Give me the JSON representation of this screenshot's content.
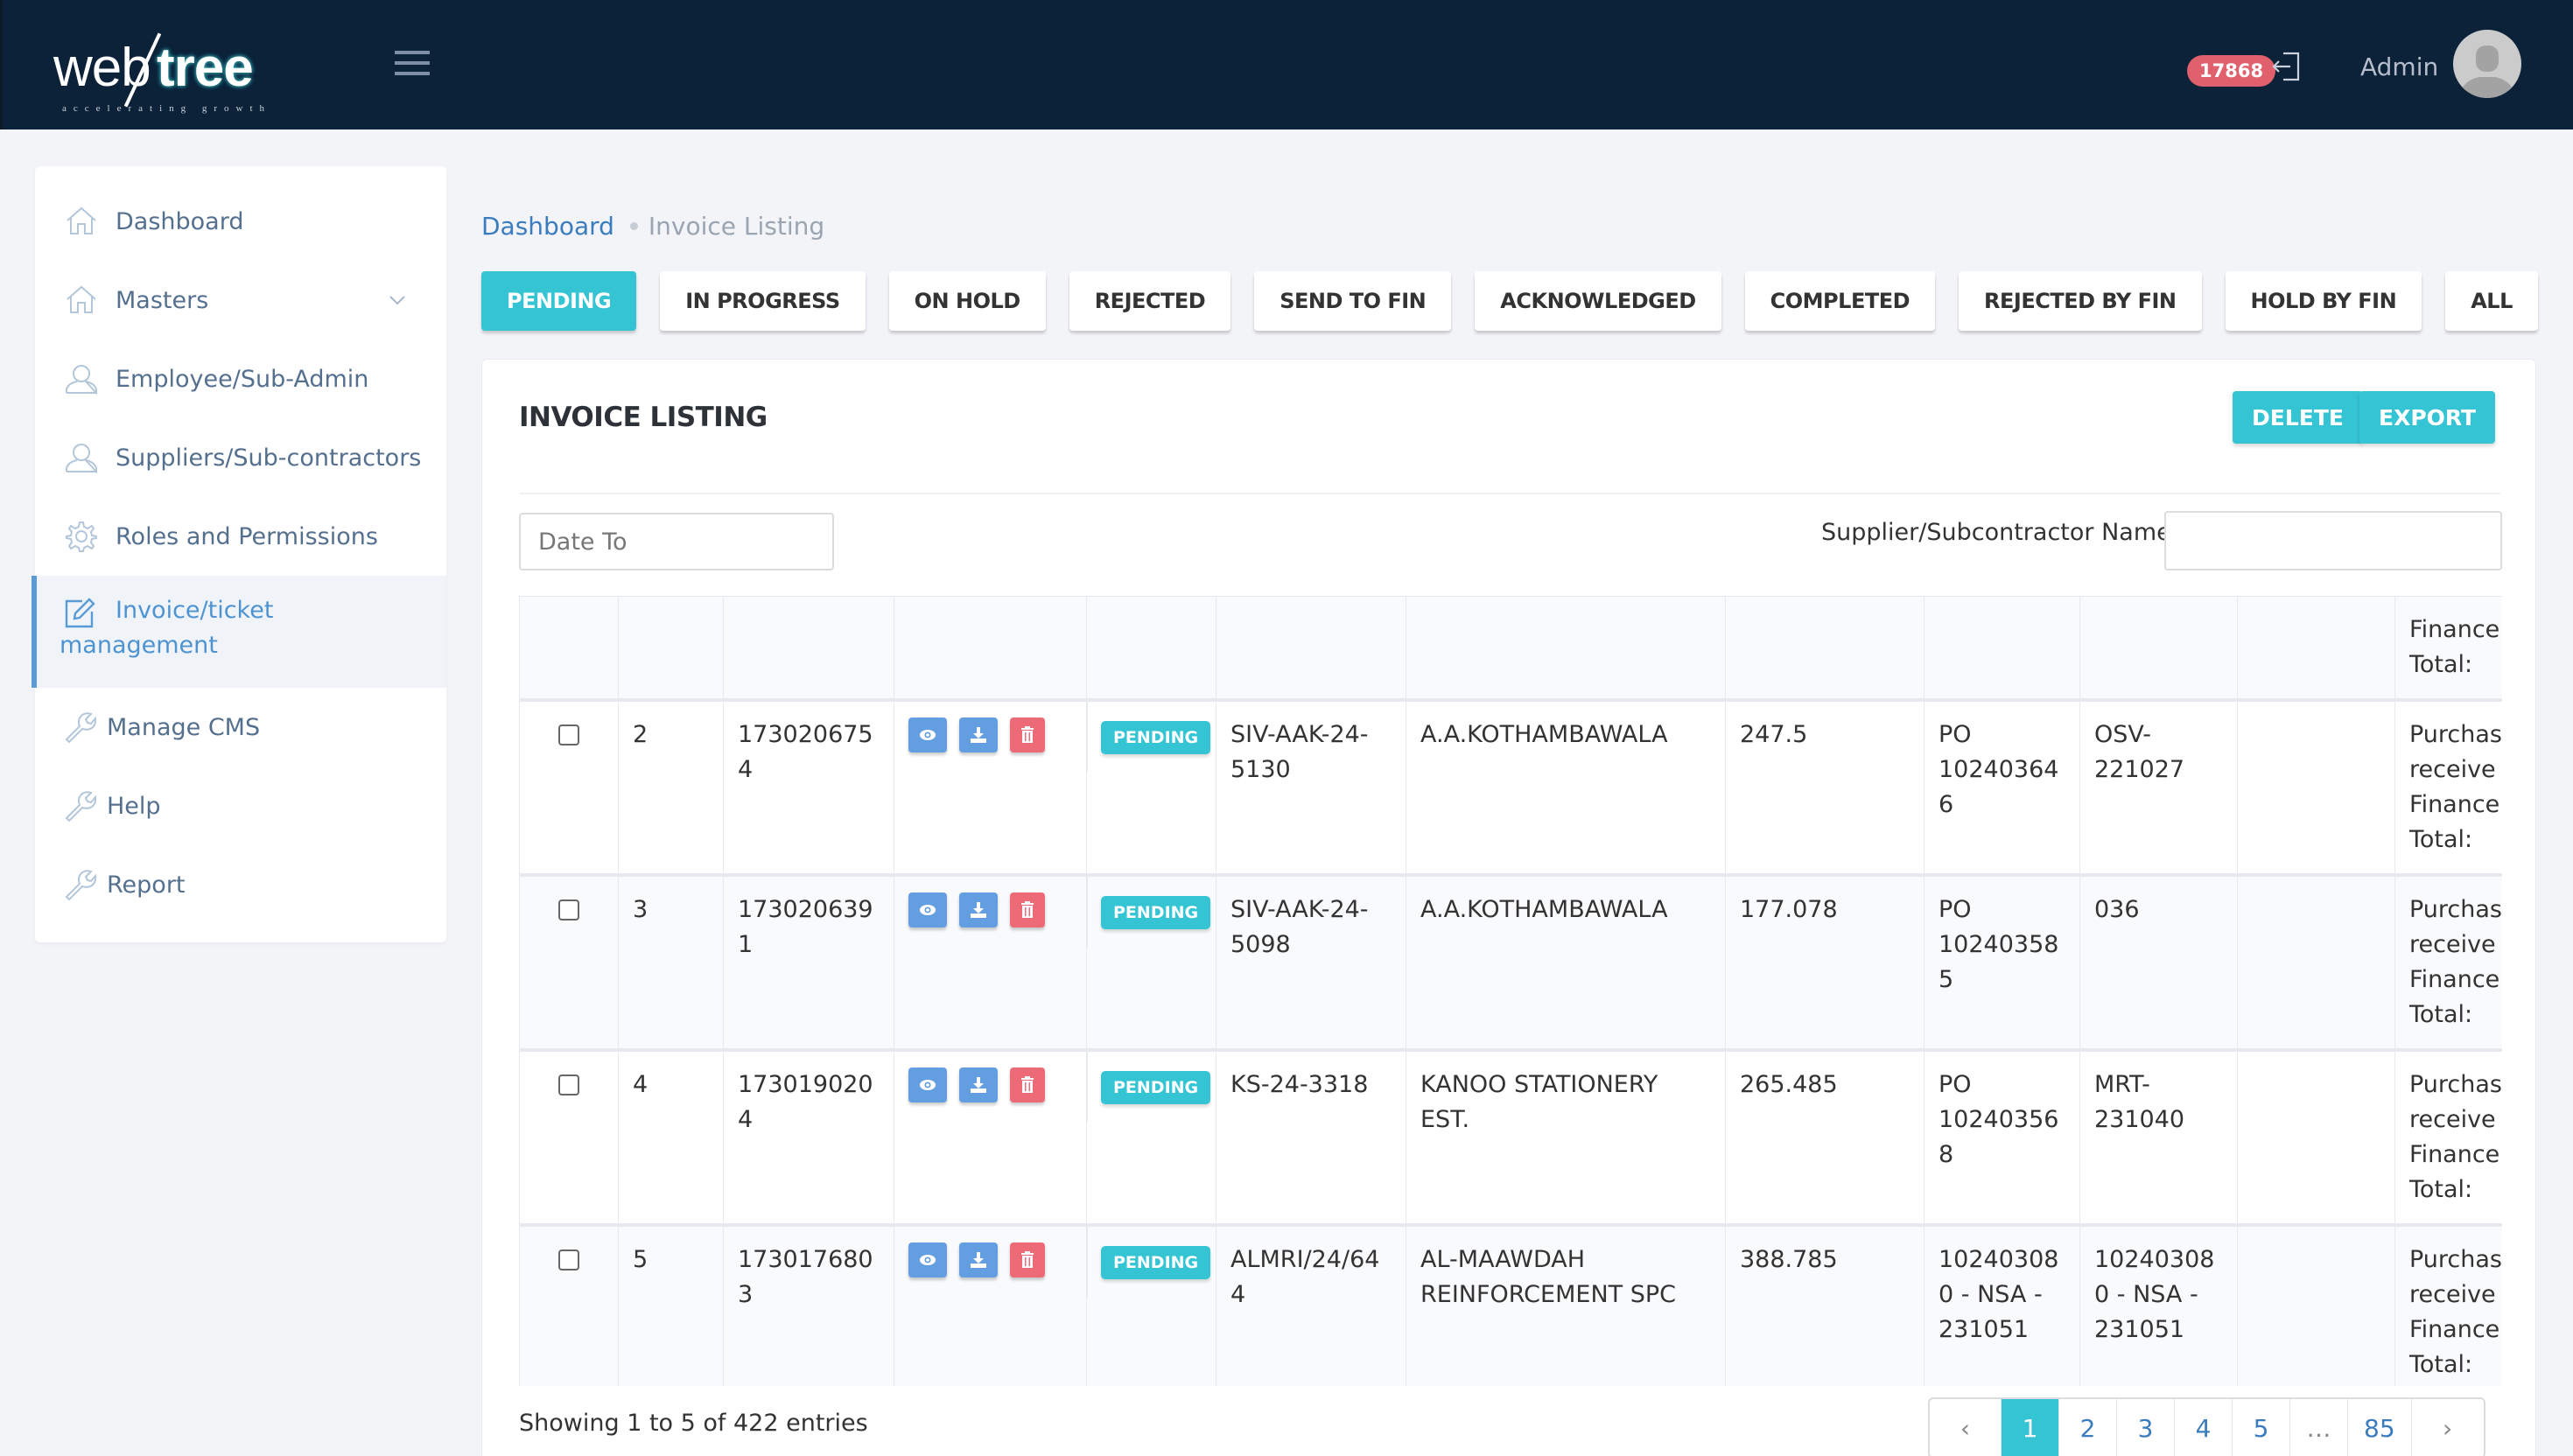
{
  "header": {
    "logo_text_web": "web",
    "logo_text_tree": "tree",
    "logo_tagline": "accelerating growth",
    "notification_count": "17868",
    "user_name": "Admin"
  },
  "sidebar": {
    "items": [
      {
        "label": "Dashboard",
        "icon": "home-icon"
      },
      {
        "label": "Masters",
        "icon": "home-icon",
        "has_dropdown": true
      },
      {
        "label": "Employee/Sub-Admin",
        "icon": "user-icon"
      },
      {
        "label": "Suppliers/Sub-contractors",
        "icon": "user-icon"
      },
      {
        "label": "Roles and Permissions",
        "icon": "gear-icon"
      },
      {
        "label": "Invoice/ticket management",
        "icon": "edit-icon",
        "active": true
      },
      {
        "label": "Manage CMS",
        "icon": "wrench-icon"
      },
      {
        "label": "Help",
        "icon": "wrench-icon"
      },
      {
        "label": "Report",
        "icon": "wrench-icon"
      }
    ]
  },
  "breadcrumb": {
    "parent": "Dashboard",
    "current": "Invoice Listing"
  },
  "status_tabs": [
    {
      "label": "PENDING",
      "active": true
    },
    {
      "label": "IN PROGRESS"
    },
    {
      "label": "ON HOLD"
    },
    {
      "label": "REJECTED"
    },
    {
      "label": "SEND TO FIN"
    },
    {
      "label": "ACKNOWLEDGED"
    },
    {
      "label": "COMPLETED"
    },
    {
      "label": "REJECTED BY FIN"
    },
    {
      "label": "HOLD BY FIN"
    },
    {
      "label": "ALL"
    }
  ],
  "listing": {
    "title": "INVOICE LISTING",
    "delete_label": "DELETE",
    "export_label": "EXPORT",
    "date_to_placeholder": "Date To",
    "supplier_filter_label": "Supplier/Subcontractor Name",
    "supplier_filter_value": ""
  },
  "table": {
    "partial_top_row": {
      "notes": [
        "Finance:",
        "Total:"
      ]
    },
    "rows": [
      {
        "index": "2",
        "id": "1730206754",
        "status": "PENDING",
        "invoice_no": "SIV-AAK-24-5130",
        "supplier": "A.A.KOTHAMBAWALA",
        "amount": "247.5",
        "po_number": "PO 102403646",
        "reference": "OSV-221027",
        "extra": "",
        "notes": [
          "Purchas",
          "receive",
          "Finance:",
          "Total:"
        ]
      },
      {
        "index": "3",
        "id": "1730206391",
        "status": "PENDING",
        "invoice_no": "SIV-AAK-24-5098",
        "supplier": "A.A.KOTHAMBAWALA",
        "amount": "177.078",
        "po_number": "PO 102403585",
        "reference": "036",
        "extra": "",
        "notes": [
          "Purchas",
          "receive",
          "Finance:",
          "Total:"
        ]
      },
      {
        "index": "4",
        "id": "1730190204",
        "status": "PENDING",
        "invoice_no": "KS-24-3318",
        "supplier": "KANOO STATIONERY EST.",
        "amount": "265.485",
        "po_number": "PO 102403568",
        "reference": "MRT-231040",
        "extra": "",
        "notes": [
          "Purchas",
          "receive",
          "Finance:",
          "Total:"
        ]
      },
      {
        "index": "5",
        "id": "1730176803",
        "status": "PENDING",
        "invoice_no": "ALMRI/24/644",
        "supplier": "AL-MAAWDAH REINFORCEMENT SPC",
        "amount": "388.785",
        "po_number": "102403080 - NSA - 231051",
        "reference": "102403080 - NSA - 231051",
        "extra": "",
        "notes": [
          "Purchas",
          "receive",
          "Finance:",
          "Total:"
        ]
      }
    ]
  },
  "footer": {
    "showing_text": "Showing 1 to 5 of 422 entries",
    "pages": [
      "1",
      "2",
      "3",
      "4",
      "5",
      "…",
      "85"
    ],
    "current_page": "1",
    "prev_label": "‹",
    "next_label": "›"
  },
  "colors": {
    "topbar": "#0b2238",
    "accent_teal": "#34c4d3",
    "action_blue": "#639fe0",
    "action_red": "#ec6b76",
    "badge_red": "#e0606d",
    "sidebar_active": "#4e93d1"
  }
}
